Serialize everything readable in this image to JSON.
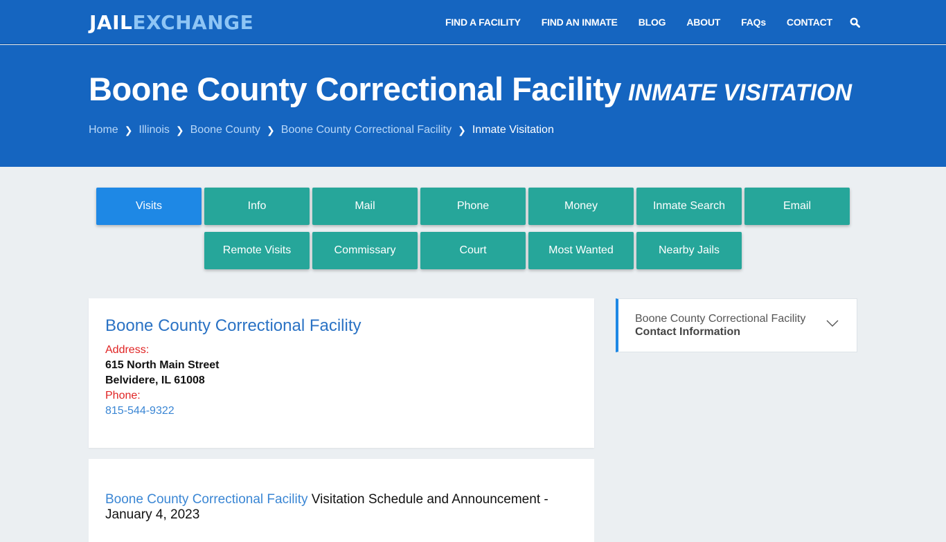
{
  "header": {
    "logo_part1": "JAIL",
    "logo_part2": "EXCHANGE",
    "nav": [
      {
        "label": "FIND A FACILITY"
      },
      {
        "label": "FIND AN INMATE"
      },
      {
        "label": "BLOG"
      },
      {
        "label": "ABOUT"
      },
      {
        "label": "FAQs"
      },
      {
        "label": "CONTACT"
      }
    ],
    "search_icon": "search-icon"
  },
  "hero": {
    "title": "Boone County Correctional Facility",
    "subtitle": "INMATE VISITATION",
    "breadcrumb": [
      {
        "label": "Home"
      },
      {
        "label": "Illinois"
      },
      {
        "label": "Boone County"
      },
      {
        "label": "Boone County Correctional Facility"
      },
      {
        "label": "Inmate Visitation"
      }
    ]
  },
  "tabs": {
    "row1": [
      {
        "label": "Visits",
        "active": true
      },
      {
        "label": "Info"
      },
      {
        "label": "Mail"
      },
      {
        "label": "Phone"
      },
      {
        "label": "Money"
      },
      {
        "label": "Inmate Search"
      },
      {
        "label": "Email"
      }
    ],
    "row2": [
      {
        "label": "Remote Visits"
      },
      {
        "label": "Commissary"
      },
      {
        "label": "Court"
      },
      {
        "label": "Most Wanted"
      },
      {
        "label": "Nearby Jails"
      }
    ]
  },
  "facility_card": {
    "name": "Boone County Correctional Facility",
    "address_label": "Address:",
    "address_line1": "615 North Main Street",
    "address_line2": "Belvidere, IL 61008",
    "phone_label": "Phone:",
    "phone": "815-544-9322"
  },
  "announcement": {
    "facility_link": "Boone County Correctional Facility",
    "text": " Visitation Schedule and Announcement - January 4, 2023"
  },
  "sidebar": {
    "line1": "Boone County Correctional Facility",
    "line2": "Contact Information"
  },
  "colors": {
    "header_blue": "#1565c0",
    "tab_teal": "#26a69a",
    "tab_active": "#1e88e5",
    "label_red": "#e02424",
    "link_blue": "#3a86d4"
  }
}
